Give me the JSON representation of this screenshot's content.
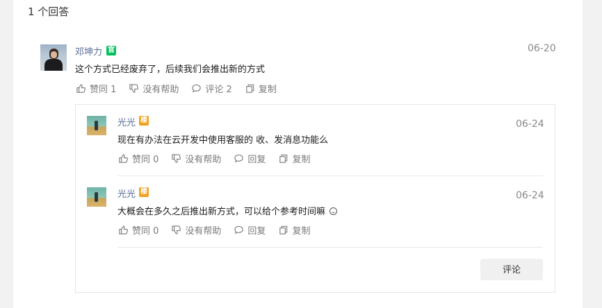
{
  "answers_count": "1 个回答",
  "answer": {
    "author": "邓坤力",
    "badge": "官",
    "date": "06-20",
    "content": "这个方式已经废弃了，后续我们会推出新的方式",
    "actions": {
      "like": "赞同 1",
      "unhelpful": "没有帮助",
      "comments": "评论 2",
      "copy": "复制"
    }
  },
  "replies": [
    {
      "author": "光光",
      "badge": "楼",
      "date": "06-24",
      "content": "现在有办法在云开发中使用客服的 收、发消息功能么",
      "actions": {
        "like": "赞同 0",
        "unhelpful": "没有帮助",
        "reply": "回复",
        "copy": "复制"
      }
    },
    {
      "author": "光光",
      "badge": "楼",
      "date": "06-24",
      "content": "大概会在多久之后推出新方式，可以给个参考时间嘛",
      "actions": {
        "like": "赞同 0",
        "unhelpful": "没有帮助",
        "reply": "回复",
        "copy": "复制"
      }
    }
  ],
  "comment_button": "评论",
  "colors": {
    "name": "#576b95",
    "official_badge": "#07c160",
    "op_badge": "#f0a020"
  }
}
